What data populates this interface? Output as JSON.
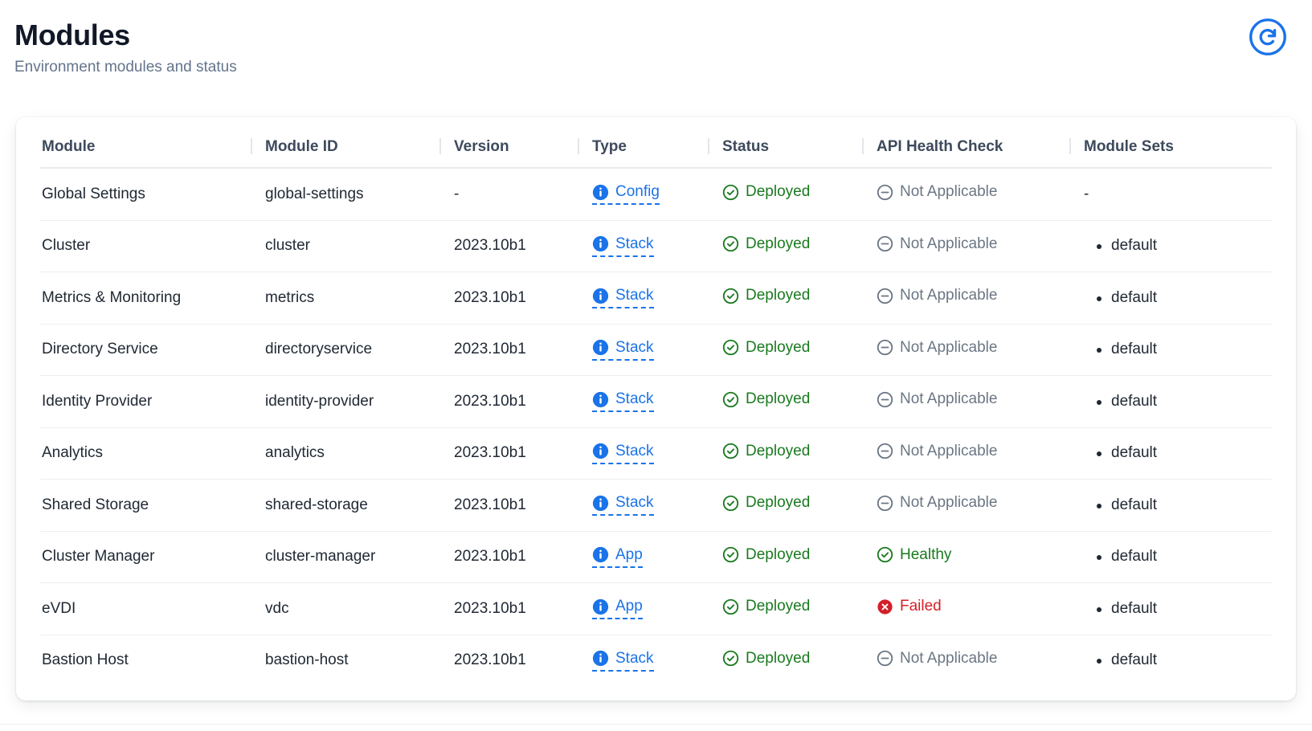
{
  "header": {
    "title": "Modules",
    "subtitle": "Environment modules and status",
    "refresh_icon": "refresh-circle-icon",
    "refresh_label": "Refresh"
  },
  "colors": {
    "accent_blue": "#1a73e8",
    "success_green": "#1a7a1f",
    "error_red": "#d32029",
    "neutral_gray": "#6b7684",
    "title_navy": "#111827"
  },
  "table": {
    "columns": [
      {
        "key": "module",
        "label": "Module"
      },
      {
        "key": "id",
        "label": "Module ID"
      },
      {
        "key": "version",
        "label": "Version"
      },
      {
        "key": "type",
        "label": "Type"
      },
      {
        "key": "status",
        "label": "Status"
      },
      {
        "key": "health",
        "label": "API Health Check"
      },
      {
        "key": "sets",
        "label": "Module Sets"
      }
    ],
    "rows": [
      {
        "module": "Global Settings",
        "id": "global-settings",
        "version": "-",
        "type": "Config",
        "type_icon": "info-icon",
        "status": "Deployed",
        "status_icon": "check-circle-icon",
        "status_state": "ok",
        "health": "Not Applicable",
        "health_icon": "minus-circle-icon",
        "health_state": "na",
        "sets": [],
        "sets_empty": "-"
      },
      {
        "module": "Cluster",
        "id": "cluster",
        "version": "2023.10b1",
        "type": "Stack",
        "type_icon": "info-icon",
        "status": "Deployed",
        "status_icon": "check-circle-icon",
        "status_state": "ok",
        "health": "Not Applicable",
        "health_icon": "minus-circle-icon",
        "health_state": "na",
        "sets": [
          "default"
        ],
        "sets_empty": ""
      },
      {
        "module": "Metrics & Monitoring",
        "id": "metrics",
        "version": "2023.10b1",
        "type": "Stack",
        "type_icon": "info-icon",
        "status": "Deployed",
        "status_icon": "check-circle-icon",
        "status_state": "ok",
        "health": "Not Applicable",
        "health_icon": "minus-circle-icon",
        "health_state": "na",
        "sets": [
          "default"
        ],
        "sets_empty": ""
      },
      {
        "module": "Directory Service",
        "id": "directoryservice",
        "version": "2023.10b1",
        "type": "Stack",
        "type_icon": "info-icon",
        "status": "Deployed",
        "status_icon": "check-circle-icon",
        "status_state": "ok",
        "health": "Not Applicable",
        "health_icon": "minus-circle-icon",
        "health_state": "na",
        "sets": [
          "default"
        ],
        "sets_empty": ""
      },
      {
        "module": "Identity Provider",
        "id": "identity-provider",
        "version": "2023.10b1",
        "type": "Stack",
        "type_icon": "info-icon",
        "status": "Deployed",
        "status_icon": "check-circle-icon",
        "status_state": "ok",
        "health": "Not Applicable",
        "health_icon": "minus-circle-icon",
        "health_state": "na",
        "sets": [
          "default"
        ],
        "sets_empty": ""
      },
      {
        "module": "Analytics",
        "id": "analytics",
        "version": "2023.10b1",
        "type": "Stack",
        "type_icon": "info-icon",
        "status": "Deployed",
        "status_icon": "check-circle-icon",
        "status_state": "ok",
        "health": "Not Applicable",
        "health_icon": "minus-circle-icon",
        "health_state": "na",
        "sets": [
          "default"
        ],
        "sets_empty": ""
      },
      {
        "module": "Shared Storage",
        "id": "shared-storage",
        "version": "2023.10b1",
        "type": "Stack",
        "type_icon": "info-icon",
        "status": "Deployed",
        "status_icon": "check-circle-icon",
        "status_state": "ok",
        "health": "Not Applicable",
        "health_icon": "minus-circle-icon",
        "health_state": "na",
        "sets": [
          "default"
        ],
        "sets_empty": ""
      },
      {
        "module": "Cluster Manager",
        "id": "cluster-manager",
        "version": "2023.10b1",
        "type": "App",
        "type_icon": "info-icon",
        "status": "Deployed",
        "status_icon": "check-circle-icon",
        "status_state": "ok",
        "health": "Healthy",
        "health_icon": "check-circle-icon",
        "health_state": "ok",
        "sets": [
          "default"
        ],
        "sets_empty": ""
      },
      {
        "module": "eVDI",
        "id": "vdc",
        "version": "2023.10b1",
        "type": "App",
        "type_icon": "info-icon",
        "status": "Deployed",
        "status_icon": "check-circle-icon",
        "status_state": "ok",
        "health": "Failed",
        "health_icon": "error-circle-icon",
        "health_state": "fail",
        "sets": [
          "default"
        ],
        "sets_empty": ""
      },
      {
        "module": "Bastion Host",
        "id": "bastion-host",
        "version": "2023.10b1",
        "type": "Stack",
        "type_icon": "info-icon",
        "status": "Deployed",
        "status_icon": "check-circle-icon",
        "status_state": "ok",
        "health": "Not Applicable",
        "health_icon": "minus-circle-icon",
        "health_state": "na",
        "sets": [
          "default"
        ],
        "sets_empty": ""
      }
    ]
  }
}
